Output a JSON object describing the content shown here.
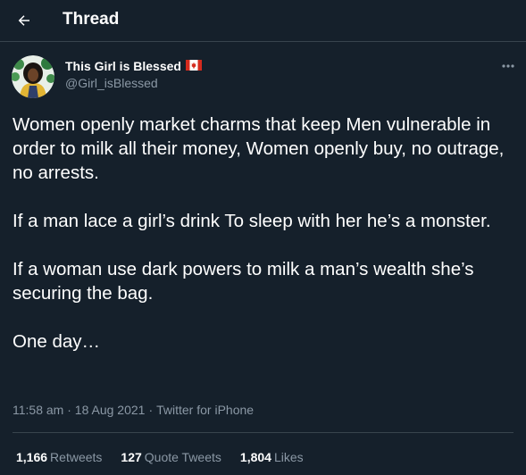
{
  "header": {
    "title": "Thread",
    "back_icon": "arrow-left-icon"
  },
  "author": {
    "display_name": "This Girl is Blessed",
    "flag_icon": "canada-flag-icon",
    "handle": "@Girl_isBlessed"
  },
  "tweet": {
    "paragraphs": [
      "Women openly market charms that keep Men vulnerable in order to milk all their money, Women openly buy, no outrage, no arrests.",
      "If a man lace a girl’s drink To sleep with her he’s a monster.",
      "If a woman use dark powers to milk a man’s wealth she’s securing the bag.",
      "One day…"
    ],
    "time": "11:58 am",
    "date": "18 Aug 2021",
    "source": "Twitter for iPhone",
    "separator": "·"
  },
  "stats": {
    "retweets_count": "1,166",
    "retweets_label": "Retweets",
    "quotes_count": "127",
    "quotes_label": "Quote Tweets",
    "likes_count": "1,804",
    "likes_label": "Likes"
  },
  "colors": {
    "background": "#15202b",
    "secondary_text": "#8b98a5",
    "border": "#38444d"
  }
}
